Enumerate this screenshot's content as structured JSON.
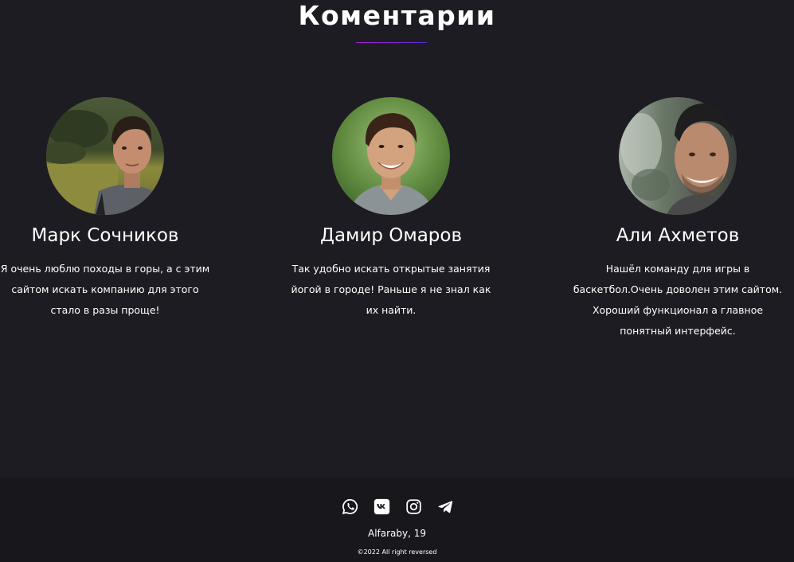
{
  "comments": {
    "title": "Коментарии",
    "underline_colors": [
      "#b01ed6",
      "#5a2fd8"
    ],
    "cards": [
      {
        "name": "Марк Сочников",
        "text": "Я очень люблю походы в горы, а с этим сайтом искать компанию для этого стало в разы проще!"
      },
      {
        "name": "Дамир Омаров",
        "text": "Так удобно искать открытые занятия йогой в городе! Раньше я не знал как их найти."
      },
      {
        "name": "Али Ахметов",
        "text": "Нашёл команду для игры в баскетбол.Очень доволен этим сайтом. Хороший функционал а главное понятный интерфейс."
      }
    ]
  },
  "footer": {
    "socials": [
      {
        "icon": "whatsapp-icon"
      },
      {
        "icon": "vk-icon"
      },
      {
        "icon": "instagram-icon"
      },
      {
        "icon": "telegram-icon"
      }
    ],
    "address": "Alfaraby, 19",
    "copyright": "©2022 All right reversed"
  },
  "colors": {
    "background": "#1d1c22",
    "footer_background": "#18171c",
    "text": "#ffffff"
  }
}
